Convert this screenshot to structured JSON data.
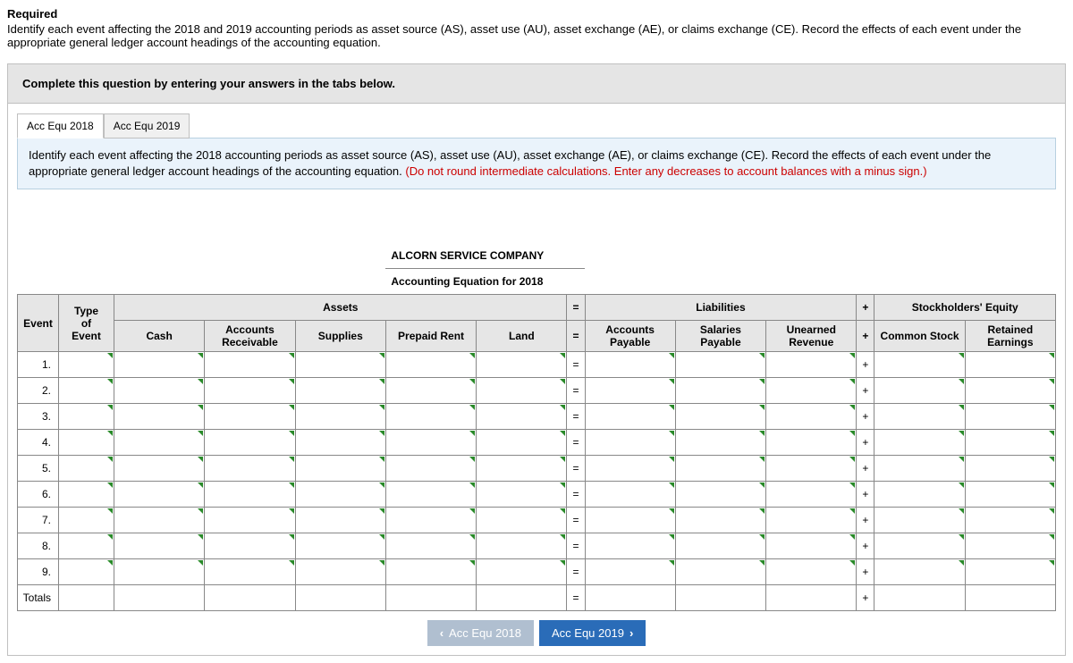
{
  "header": {
    "required": "Required",
    "intro": "Identify each event affecting the 2018 and 2019 accounting periods as asset source (AS), asset use (AU), asset exchange (AE), or claims exchange (CE). Record the effects of each event under the appropriate general ledger account headings of the accounting equation."
  },
  "graybox": {
    "text": "Complete this question by entering your answers in the tabs below."
  },
  "tabs": {
    "t1": "Acc Equ 2018",
    "t2": "Acc Equ 2019"
  },
  "instruction": {
    "main": "Identify each event affecting the 2018 accounting periods as asset source (AS), asset use (AU), asset exchange (AE), or claims exchange (CE). Record the effects of each event under the appropriate general ledger account headings of the accounting equation. ",
    "red": "(Do not round intermediate calculations. Enter any decreases to account balances with a minus sign.)"
  },
  "table": {
    "company": "ALCORN SERVICE COMPANY",
    "subtitle": "Accounting Equation for 2018",
    "groups": {
      "event": "Event",
      "type": "Type\nof\nEvent",
      "assets": "Assets",
      "eq": "=",
      "liabilities": "Liabilities",
      "plus": "+",
      "equity": "Stockholders' Equity"
    },
    "cols": {
      "cash": "Cash",
      "ar": "Accounts Receivable",
      "supplies": "Supplies",
      "prepaid": "Prepaid Rent",
      "land": "Land",
      "ap": "Accounts Payable",
      "sp": "Salaries Payable",
      "ur": "Unearned Revenue",
      "cs": "Common Stock",
      "re": "Retained Earnings"
    },
    "rows": [
      "1.",
      "2.",
      "3.",
      "4.",
      "5.",
      "6.",
      "7.",
      "8.",
      "9.",
      "Totals"
    ],
    "sym_eq": "=",
    "sym_plus": "+"
  },
  "nav": {
    "prev": "Acc Equ 2018",
    "next": "Acc Equ 2019"
  }
}
